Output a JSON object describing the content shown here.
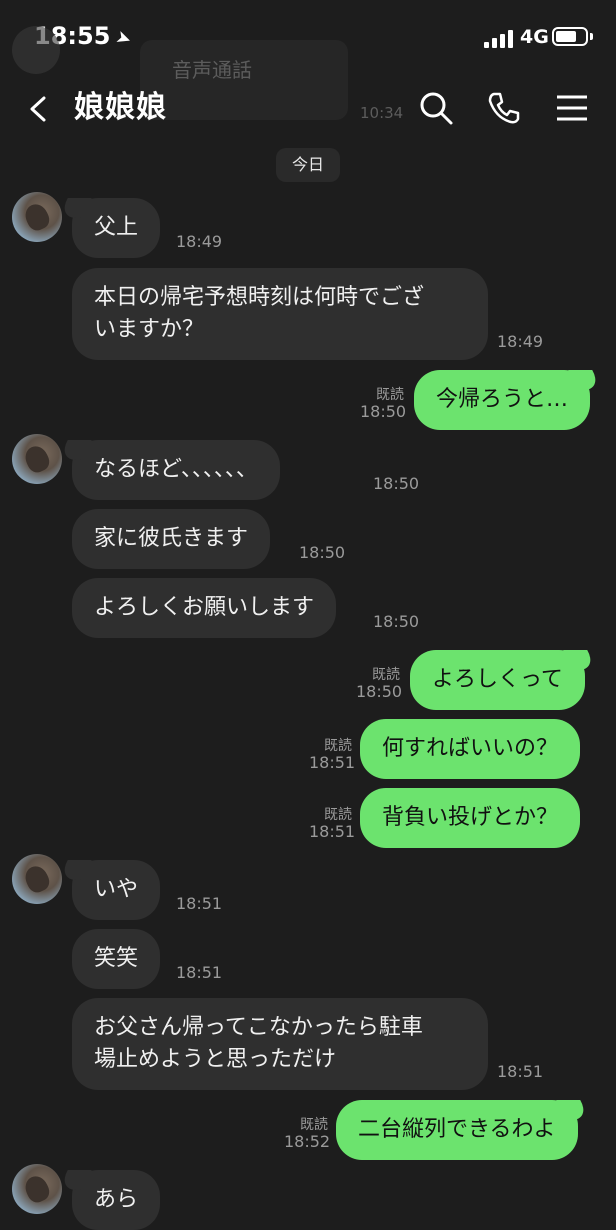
{
  "status_bar": {
    "time": "18:55",
    "network": "4G",
    "battery_level": 0.7
  },
  "background_ghost": {
    "call_label": "音声通話",
    "call_time": "10:34"
  },
  "header": {
    "title": "娘娘娘"
  },
  "date_divider": "今日",
  "messages": [
    {
      "side": "in",
      "text": "父上",
      "time": "18:49",
      "avatar": true
    },
    {
      "side": "in",
      "text": "本日の帰宅予想時刻は何時でござ\nいますか？",
      "time": "18:49"
    },
    {
      "side": "out",
      "text": "今帰ろうと…",
      "time": "18:50",
      "read": "既読"
    },
    {
      "side": "in",
      "text": "なるほど、、、、、、",
      "time": "18:50",
      "avatar": true
    },
    {
      "side": "in",
      "text": "家に彼氏きます",
      "time": "18:50"
    },
    {
      "side": "in",
      "text": "よろしくお願いします",
      "time": "18:50"
    },
    {
      "side": "out",
      "text": "よろしくって",
      "time": "18:50",
      "read": "既読"
    },
    {
      "side": "out",
      "text": "何すればいいの？",
      "time": "18:51",
      "read": "既読"
    },
    {
      "side": "out",
      "text": "背負い投げとか？",
      "time": "18:51",
      "read": "既読"
    },
    {
      "side": "in",
      "text": "いや",
      "time": "18:51",
      "avatar": true
    },
    {
      "side": "in",
      "text": "笑笑",
      "time": "18:51"
    },
    {
      "side": "in",
      "text": "お父さん帰ってこなかったら駐車\n場止めようと思っただけ",
      "time": "18:51"
    },
    {
      "side": "out",
      "text": "二台縦列できるわよ",
      "time": "18:52",
      "read": "既読"
    },
    {
      "side": "in",
      "text": "あら",
      "time": "",
      "avatar": true
    }
  ]
}
